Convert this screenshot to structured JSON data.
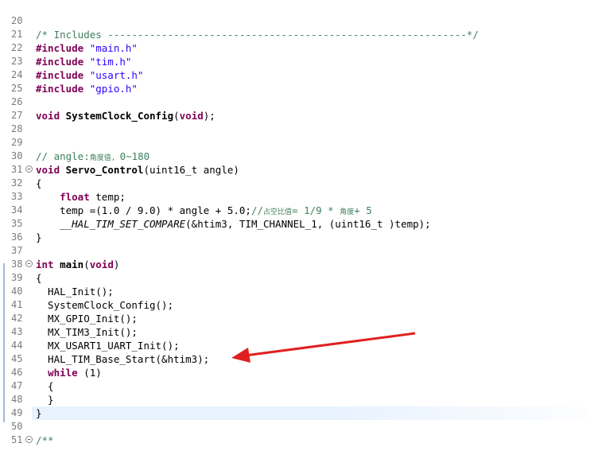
{
  "editor": {
    "lines": [
      {
        "n": "20",
        "segments": []
      },
      {
        "n": "21",
        "segments": [
          {
            "t": "/* Includes ------------------------------------------------------------*/",
            "c": "comment"
          }
        ]
      },
      {
        "n": "22",
        "segments": [
          {
            "t": "#include ",
            "c": "kw"
          },
          {
            "t": "\"main.h\"",
            "c": "str"
          }
        ]
      },
      {
        "n": "23",
        "segments": [
          {
            "t": "#include ",
            "c": "kw"
          },
          {
            "t": "\"tim.h\"",
            "c": "str"
          }
        ]
      },
      {
        "n": "24",
        "segments": [
          {
            "t": "#include ",
            "c": "kw"
          },
          {
            "t": "\"usart.h\"",
            "c": "str"
          }
        ]
      },
      {
        "n": "25",
        "segments": [
          {
            "t": "#include ",
            "c": "kw"
          },
          {
            "t": "\"gpio.h\"",
            "c": "str"
          }
        ]
      },
      {
        "n": "26",
        "segments": []
      },
      {
        "n": "27",
        "segments": [
          {
            "t": "void ",
            "c": "kw"
          },
          {
            "t": "SystemClock_Config",
            "c": "fn"
          },
          {
            "t": "(",
            "c": ""
          },
          {
            "t": "void",
            "c": "kw"
          },
          {
            "t": ");",
            "c": ""
          }
        ]
      },
      {
        "n": "28",
        "segments": []
      },
      {
        "n": "29",
        "segments": []
      },
      {
        "n": "30",
        "segments": [
          {
            "t": "// angle:",
            "c": "comment"
          },
          {
            "t": "角度值, ",
            "c": "small"
          },
          {
            "t": "0~180",
            "c": "comment"
          }
        ]
      },
      {
        "n": "31",
        "fold": true,
        "segments": [
          {
            "t": "void ",
            "c": "kw"
          },
          {
            "t": "Servo_Control",
            "c": "fn"
          },
          {
            "t": "(uint16_t angle)",
            "c": ""
          }
        ]
      },
      {
        "n": "32",
        "segments": [
          {
            "t": "{",
            "c": ""
          }
        ]
      },
      {
        "n": "33",
        "segments": [
          {
            "t": "    ",
            "c": ""
          },
          {
            "t": "float ",
            "c": "kw"
          },
          {
            "t": "temp;",
            "c": ""
          }
        ]
      },
      {
        "n": "34",
        "segments": [
          {
            "t": "    temp =(1.0 / 9.0) * angle + 5.0;",
            "c": ""
          },
          {
            "t": "//",
            "c": "comment"
          },
          {
            "t": "占空比值",
            "c": "small"
          },
          {
            "t": "= 1/9 * ",
            "c": "comment"
          },
          {
            "t": "角度",
            "c": "small"
          },
          {
            "t": "+ 5",
            "c": "comment"
          }
        ]
      },
      {
        "n": "35",
        "segments": [
          {
            "t": "    ",
            "c": ""
          },
          {
            "t": "__HAL_TIM_SET_COMPARE",
            "c": "macro"
          },
          {
            "t": "(&htim3, TIM_CHANNEL_1, (uint16_t )temp);",
            "c": ""
          }
        ]
      },
      {
        "n": "36",
        "segments": [
          {
            "t": "}",
            "c": ""
          }
        ]
      },
      {
        "n": "37",
        "segments": []
      },
      {
        "n": "38",
        "fold": true,
        "segments": [
          {
            "t": "int ",
            "c": "kw"
          },
          {
            "t": "main",
            "c": "fn"
          },
          {
            "t": "(",
            "c": ""
          },
          {
            "t": "void",
            "c": "kw"
          },
          {
            "t": ")",
            "c": ""
          }
        ]
      },
      {
        "n": "39",
        "segments": [
          {
            "t": "{",
            "c": ""
          }
        ]
      },
      {
        "n": "40",
        "segments": [
          {
            "t": "  HAL_Init();",
            "c": ""
          }
        ]
      },
      {
        "n": "41",
        "segments": [
          {
            "t": "  SystemClock_Config();",
            "c": ""
          }
        ]
      },
      {
        "n": "42",
        "segments": [
          {
            "t": "  MX_GPIO_Init();",
            "c": ""
          }
        ]
      },
      {
        "n": "43",
        "segments": [
          {
            "t": "  MX_TIM3_Init();",
            "c": ""
          }
        ]
      },
      {
        "n": "44",
        "segments": [
          {
            "t": "  MX_USART1_UART_Init();",
            "c": ""
          }
        ]
      },
      {
        "n": "45",
        "segments": [
          {
            "t": "  HAL_TIM_Base_Start(&htim3);",
            "c": ""
          }
        ]
      },
      {
        "n": "46",
        "segments": [
          {
            "t": "  ",
            "c": ""
          },
          {
            "t": "while",
            "c": "kw"
          },
          {
            "t": " (1)",
            "c": ""
          }
        ]
      },
      {
        "n": "47",
        "segments": [
          {
            "t": "  {",
            "c": ""
          }
        ]
      },
      {
        "n": "48",
        "segments": [
          {
            "t": "  }",
            "c": ""
          }
        ]
      },
      {
        "n": "49",
        "current": true,
        "segments": [
          {
            "t": "}",
            "c": ""
          }
        ]
      },
      {
        "n": "50",
        "segments": []
      },
      {
        "n": "51",
        "fold": true,
        "segments": [
          {
            "t": "/**",
            "c": "comment"
          }
        ]
      }
    ]
  },
  "annotation": {
    "color": "#e02020"
  }
}
